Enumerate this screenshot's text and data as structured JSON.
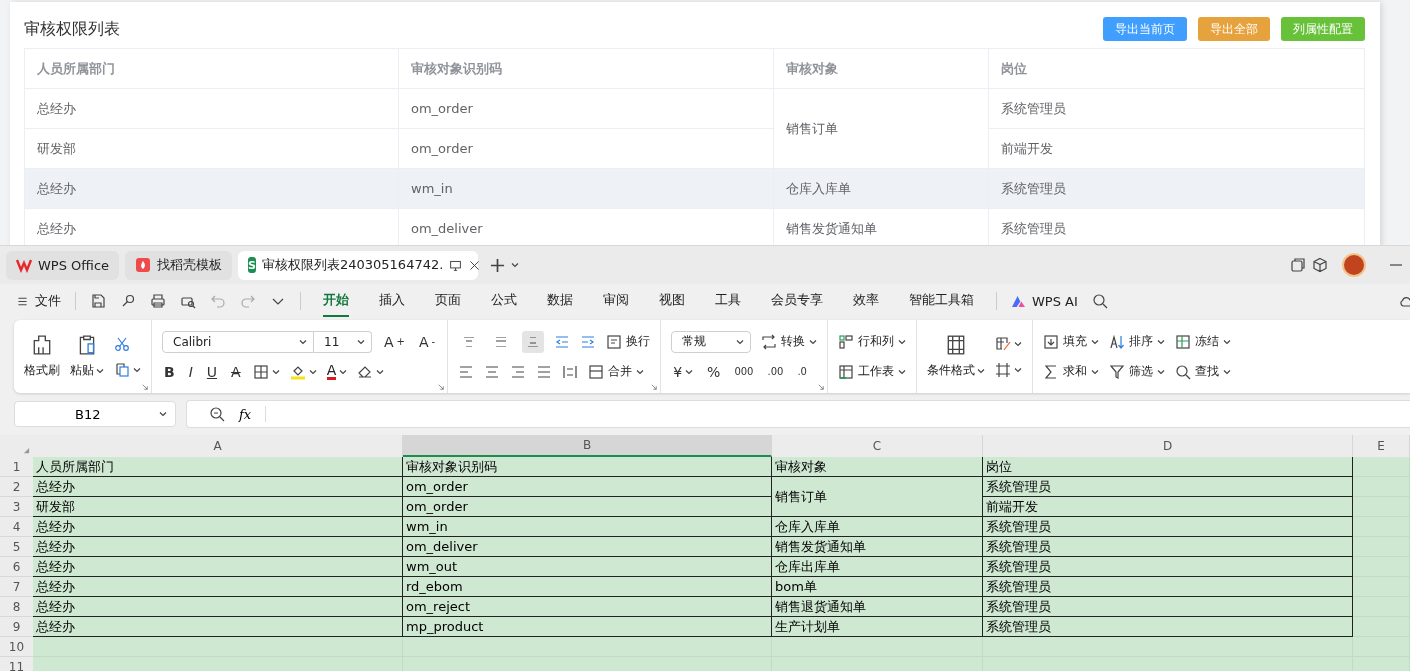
{
  "page_title": "审核权限列表",
  "buttons": [
    {
      "label": "导出当前页",
      "color": "#409eff"
    },
    {
      "label": "导出全部",
      "color": "#e6a23c"
    },
    {
      "label": "列属性配置",
      "color": "#67c23a"
    }
  ],
  "web_table": {
    "columns": [
      "人员所属部门",
      "审核对象识别码",
      "审核对象",
      "岗位"
    ],
    "rows": [
      {
        "dept": "总经办",
        "code": "om_order",
        "object": "销售订单",
        "object_merged_down": true,
        "post": "系统管理员",
        "hovered": false
      },
      {
        "dept": "研发部",
        "code": "om_order",
        "post": "前端开发",
        "hovered": false
      },
      {
        "dept": "总经办",
        "code": "wm_in",
        "object": "仓库入库单",
        "object_merged_down": false,
        "post": "系统管理员",
        "hovered": true
      },
      {
        "dept": "总经办",
        "code": "om_deliver",
        "object": "销售发货通知单",
        "object_merged_down": false,
        "post": "系统管理员",
        "hovered": false
      }
    ]
  },
  "app_tabs": [
    {
      "label": "WPS Office",
      "kind": "home",
      "selected": false
    },
    {
      "label": "找稻壳模板",
      "kind": "template",
      "selected": false
    },
    {
      "label": "审核权限列表240305164742.",
      "kind": "sheet",
      "badge": "S",
      "selected": true
    }
  ],
  "file_menu": "文件",
  "menu_tabs": [
    {
      "label": "开始",
      "selected": true
    },
    {
      "label": "插入",
      "selected": false
    },
    {
      "label": "页面",
      "selected": false
    },
    {
      "label": "公式",
      "selected": false
    },
    {
      "label": "数据",
      "selected": false
    },
    {
      "label": "审阅",
      "selected": false
    },
    {
      "label": "视图",
      "selected": false
    },
    {
      "label": "工具",
      "selected": false
    },
    {
      "label": "会员专享",
      "selected": false
    },
    {
      "label": "效率",
      "selected": false
    },
    {
      "label": "智能工具箱",
      "selected": false
    }
  ],
  "ai_button": "WPS AI",
  "ribbon": {
    "format_painter": "格式刷",
    "paste": "粘贴",
    "font": "Calibri",
    "font_size": "11",
    "grow": "A",
    "grow_sign": "+",
    "shrink": "A",
    "shrink_sign": "-",
    "bold": "B",
    "italic": "I",
    "underline": "U",
    "strike": "A",
    "font_color": "A",
    "wrap": "换行",
    "merge": "合并",
    "number_format": "常规",
    "convert": "转换",
    "currency": "¥",
    "percent": "%",
    "thousands": "000",
    "inc_decimal": ".00",
    "dec_decimal": ".0",
    "rows_cols": "行和列",
    "worksheet": "工作表",
    "conditional_format": "条件格式",
    "fill": "填充",
    "sort": "排序",
    "freeze": "冻结",
    "sum": "求和",
    "filter": "筛选",
    "find": "查找"
  },
  "align_buttons": [
    {
      "selected": false
    },
    {
      "selected": false
    },
    {
      "selected": true
    }
  ],
  "name_box": "B12",
  "formula_label": "fx",
  "sheet": {
    "columns": [
      {
        "letter": "A",
        "selected": false
      },
      {
        "letter": "B",
        "selected": true
      },
      {
        "letter": "C",
        "selected": false
      },
      {
        "letter": "D",
        "selected": false
      },
      {
        "letter": "E",
        "selected": false
      }
    ],
    "row_numbers": [
      "1",
      "2",
      "3",
      "4",
      "5",
      "6",
      "7",
      "8",
      "9",
      "10",
      "11"
    ],
    "rows": [
      {
        "a": "人员所属部门",
        "b": "审核对象识别码",
        "c": "审核对象",
        "c_merged_down": false,
        "d": "岗位"
      },
      {
        "a": "总经办",
        "b": "om_order",
        "c": "销售订单",
        "c_merged_down": true,
        "d": "系统管理员"
      },
      {
        "a": "研发部",
        "b": "om_order",
        "d": "前端开发"
      },
      {
        "a": "总经办",
        "b": "wm_in",
        "c": "仓库入库单",
        "c_merged_down": false,
        "d": "系统管理员"
      },
      {
        "a": "总经办",
        "b": "om_deliver",
        "c": "销售发货通知单",
        "c_merged_down": false,
        "d": "系统管理员"
      },
      {
        "a": "总经办",
        "b": "wm_out",
        "c": "仓库出库单",
        "c_merged_down": false,
        "d": "系统管理员"
      },
      {
        "a": "总经办",
        "b": "rd_ebom",
        "c": "bom单",
        "c_merged_down": false,
        "d": "系统管理员"
      },
      {
        "a": "总经办",
        "b": "om_reject",
        "c": "销售退货通知单",
        "c_merged_down": false,
        "d": "系统管理员"
      },
      {
        "a": "总经办",
        "b": "mp_product",
        "c": "生产计划单",
        "c_merged_down": false,
        "d": "系统管理员"
      }
    ]
  }
}
